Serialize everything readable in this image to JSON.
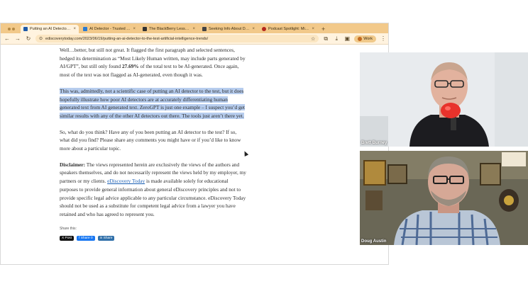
{
  "browser": {
    "tabs": [
      {
        "label": "Putting an AI Detector to the ",
        "active": true,
        "favicon_color": "#1e5aa8"
      },
      {
        "label": "AI Detector - Trusted AI Che",
        "active": false,
        "favicon_color": "#2b7bd1"
      },
      {
        "label": "The BlackBerry Lesson for e",
        "active": false,
        "favicon_color": "#333333"
      },
      {
        "label": "Seeking Info About Deepfake",
        "active": false,
        "favicon_color": "#444444"
      },
      {
        "label": "Podcast Spotlight: Mike New",
        "active": false,
        "favicon_color": "#b3261e"
      }
    ],
    "new_tab": "+",
    "url": "ediscoverytoday.com/2023/06/19/putting-an-ai-detector-to-the-test-artificial-intelligence-trends/",
    "profile": "Work"
  },
  "article": {
    "p1_a": "Well…better, but still not great. It flagged the first paragraph and selected sentences, hedged its determination as “Most Likely Human written, may include parts generated by AI/GPT”, but still only found ",
    "p1_bold": "27.69%",
    "p1_b": " of the total text to be AI-generated. Once again, most of the text was not flagged as AI-generated, even though it was.",
    "p2": "This was, admittedly, not a scientific case of putting an AI detector to the test, but it does hopefully illustrate how poor AI detectors are at accurately differentiating human generated text from AI generated text. ZeroGPT is just one example – I suspect you’d get similar results with any of the other AI detectors out there. The tools just aren’t there yet.",
    "p3": "So, what do you think? Have any of you been putting an AI detector to the test? If so, what did you find? Please share any comments you might have or if you’d like to know more about a particular topic.",
    "disclaimer_label": "Disclaimer:",
    "disclaimer_a": " The views represented herein are exclusively the views of the authors and speakers themselves, and do not necessarily represent the views held by my employer, my partners or my clients. ",
    "disclaimer_link": "eDiscovery Today",
    "disclaimer_b": " is made available solely for educational purposes to provide general information about general eDiscovery principles and not to provide specific legal advice applicable to any particular circumstance. eDiscovery Today should not be used as a substitute for competent legal advice from a lawyer you have retained and who has agreed to represent you.",
    "share_label": "Share this:",
    "share_buttons": {
      "x": "X Post",
      "fb": "f Share 0",
      "in": "in Share"
    }
  },
  "video": {
    "tiles": [
      {
        "name": "Brett Burney"
      },
      {
        "name": "Doug Austin"
      }
    ]
  },
  "colors": {
    "tabstrip": "#f2c98a",
    "highlight": "#b7cdee",
    "link": "#1a5fb4",
    "speaking_outline": "#ffffff"
  }
}
